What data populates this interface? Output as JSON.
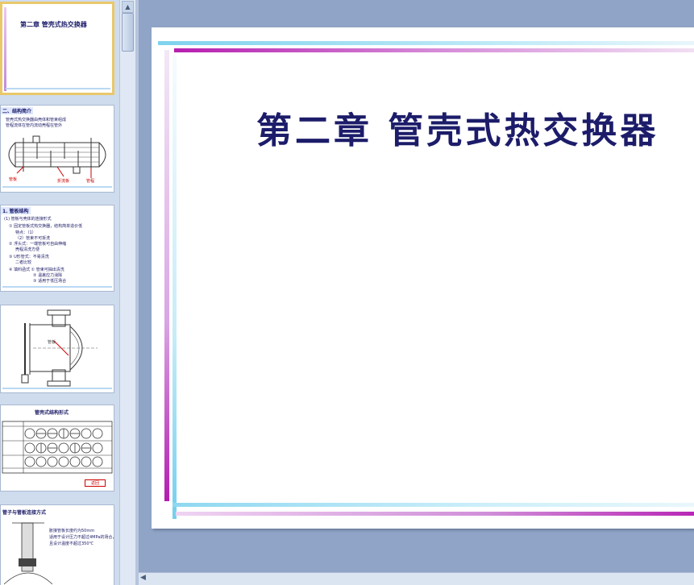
{
  "slide": {
    "title": "第二章  管壳式热交换器"
  },
  "thumbnails": [
    {
      "title": "第二章  管壳式热交换器",
      "selected": true
    },
    {
      "title": "二、结构简介",
      "labels": [
        "管板",
        "折流板",
        "管程"
      ]
    },
    {
      "title": "1. 管板结构"
    },
    {
      "title": "",
      "labels": [
        "管板"
      ]
    },
    {
      "title": "管壳式结构形式",
      "button": "返回"
    },
    {
      "title": "管子与管板连接方式"
    }
  ],
  "icons": {
    "thumb_scroll_up": "up-arrow-icon",
    "hscroll_left": "left-arrow-icon"
  }
}
